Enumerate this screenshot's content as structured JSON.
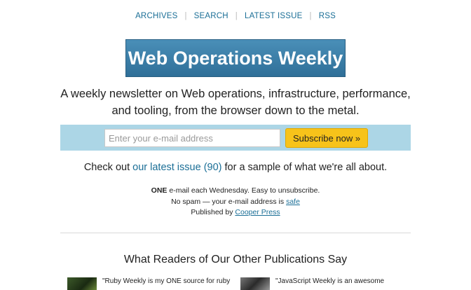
{
  "nav": {
    "items": [
      "ARCHIVES",
      "SEARCH",
      "LATEST ISSUE",
      "RSS"
    ],
    "separator": "|"
  },
  "logo": {
    "text": "Web Operations Weekly"
  },
  "tagline": {
    "line1": "A weekly newsletter on Web operations, infrastructure, performance,",
    "line2": "and tooling, from the browser down to the metal."
  },
  "signup": {
    "email_placeholder": "Enter your e-mail address",
    "button_label": "Subscribe now »"
  },
  "checkout": {
    "prefix": "Check out ",
    "link": "our latest issue (90)",
    "suffix": " for a sample of what we're all about."
  },
  "fine_print": {
    "bold": "ONE",
    "line1_rest": " e-mail each Wednesday. Easy to unsubscribe.",
    "line2_prefix": "No spam — your e-mail address is ",
    "line2_link": "safe",
    "line3_prefix": "Published by ",
    "line3_link": "Cooper Press"
  },
  "readers": {
    "title": "What Readers of Our Other Publications Say",
    "testimonials": [
      {
        "quote": "\"Ruby Weekly is my ONE source for ruby"
      },
      {
        "quote": "\"JavaScript Weekly is an awesome"
      }
    ]
  },
  "colors": {
    "link": "#1a6e96",
    "logo_bg": "#3a7fab",
    "signup_band": "#acd6e6",
    "button": "#f7c31a"
  }
}
